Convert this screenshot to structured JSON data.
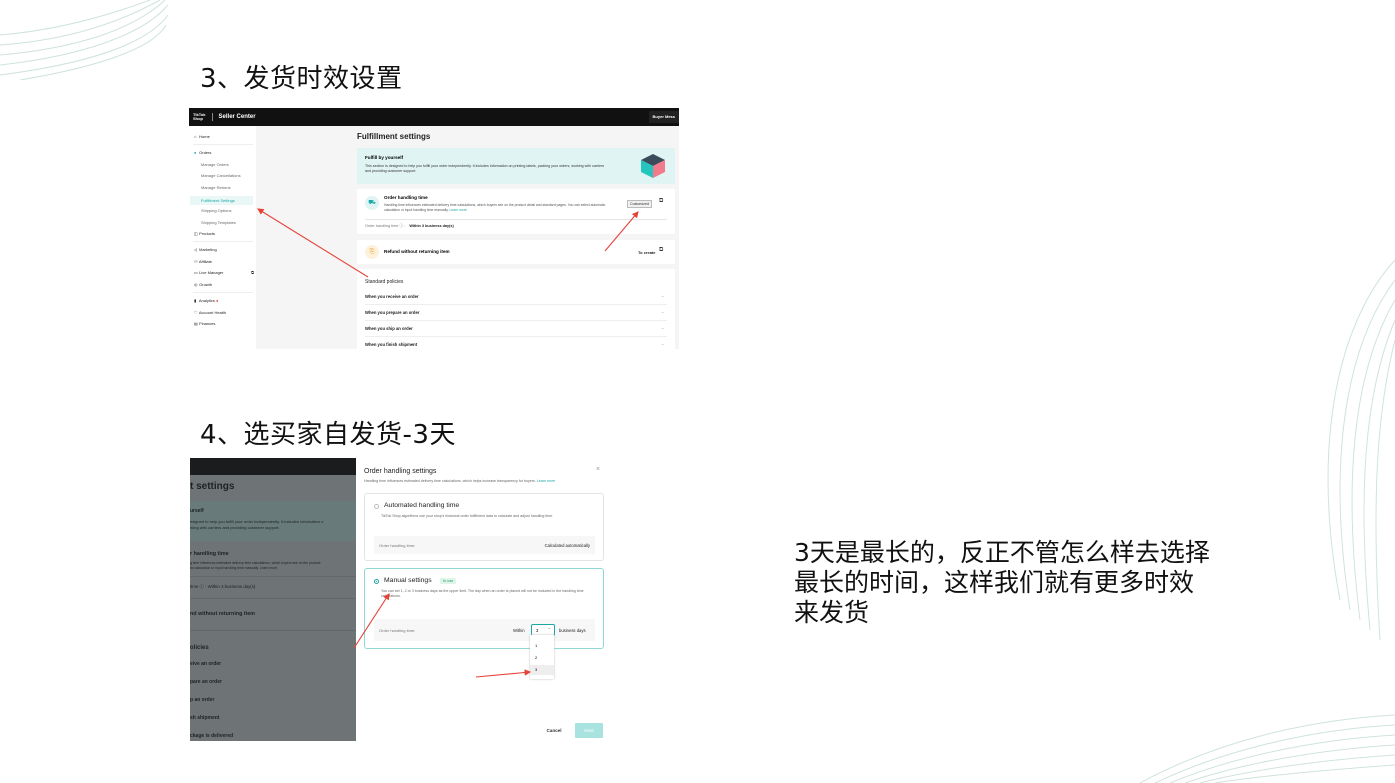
{
  "headings": {
    "step3": "3、发货时效设置",
    "step4": "4、选买家自发货-3天"
  },
  "note": "3天是最长的，反正不管怎么样去选择最长的时间，这样我们就有更多时效来发货",
  "shot1": {
    "topbar": {
      "logo": "TikTok Shop",
      "logo_line1": "TikTok",
      "logo_line2": "Shop",
      "app": "Seller Center",
      "account": "Buyer Mess"
    },
    "sidebar": {
      "home": "Home",
      "orders": "Orders",
      "manage_orders": "Manage Orders",
      "manage_cancellations": "Manage Cancellations",
      "manage_returns": "Manage Returns",
      "fulfillment_settings": "Fulfillment Settings",
      "shipping_options": "Shipping Options",
      "shipping_templates": "Shipping Templates",
      "products": "Products",
      "marketing": "Marketing",
      "affiliate": "Affiliate",
      "live_manager": "Live Manager",
      "growth": "Growth",
      "analytics": "Analytics",
      "account_health": "Account Health",
      "finances": "Finances"
    },
    "page_title": "Fulfillment settings",
    "banner": {
      "title": "Fulfill by yourself",
      "desc": "This section is designed to help you fulfill your order independently. It includes information on printing labels, packing your orders, working with carriers and providing customer support."
    },
    "order_handling": {
      "title": "Order handling time",
      "desc": "Handling time influences estimated delivery time calculations, which buyers see on the product detail and standard pages. You can select automatic calculation or input handling time manually.",
      "learn_more": "Learn more",
      "badge": "Customized",
      "label": "Order handling time ⓘ :",
      "value": "Within 3 business day(s)"
    },
    "refund": {
      "title": "Refund without returning item",
      "action": "To create"
    },
    "standard_policies": {
      "title": "Standard policies",
      "items": [
        "When you receive an order",
        "When you prepare an order",
        "When you ship an order",
        "When you finish shipment"
      ]
    }
  },
  "shot2": {
    "background": {
      "title": "t settings",
      "banner_title": "urself",
      "banner_line1": "esigned to help you fulfill your order independently. It includes information o",
      "banner_line2": "rking with carriers and providing customer support.",
      "oh_title": "r handling time",
      "oh_line1": "g time influences estimated delivery time calculations, which buyers see on the product",
      "oh_line2": "tic calculation or input handling time manually.",
      "oh_learn": "Learn more",
      "oh_kv": "time ⓘ :   Within 3 business day(s)",
      "refund": "nd without returning item",
      "policies": "olicies",
      "p1": "eive an order",
      "p2": "pare an order",
      "p3": "p an order",
      "p4": "sh shipment",
      "p5": "ckage is delivered"
    },
    "modal": {
      "title": "Order handling settings",
      "close": "×",
      "desc": "Handling time influences estimated delivery time calculations, which helps increase transparency for buyers.",
      "learn_more": "Learn more",
      "automated": {
        "title": "Automated handling time",
        "desc": "TikTok Shop algorithms use your shop's historical order fulfillment data to calculate and adjust handling time.",
        "label": "Order handling time:",
        "value": "Calculated automatically"
      },
      "manual": {
        "title": "Manual settings",
        "tag": "In use",
        "desc": "You can set 1, 2 or 3 business days as the upper limit. The day when an order is placed will not be included in the handling time calculations.",
        "label": "Order handling time:",
        "within": "Within",
        "selected": "3",
        "unit": "business days"
      },
      "options": [
        "1",
        "2",
        "3"
      ],
      "cancel": "Cancel",
      "next": "Next"
    }
  }
}
